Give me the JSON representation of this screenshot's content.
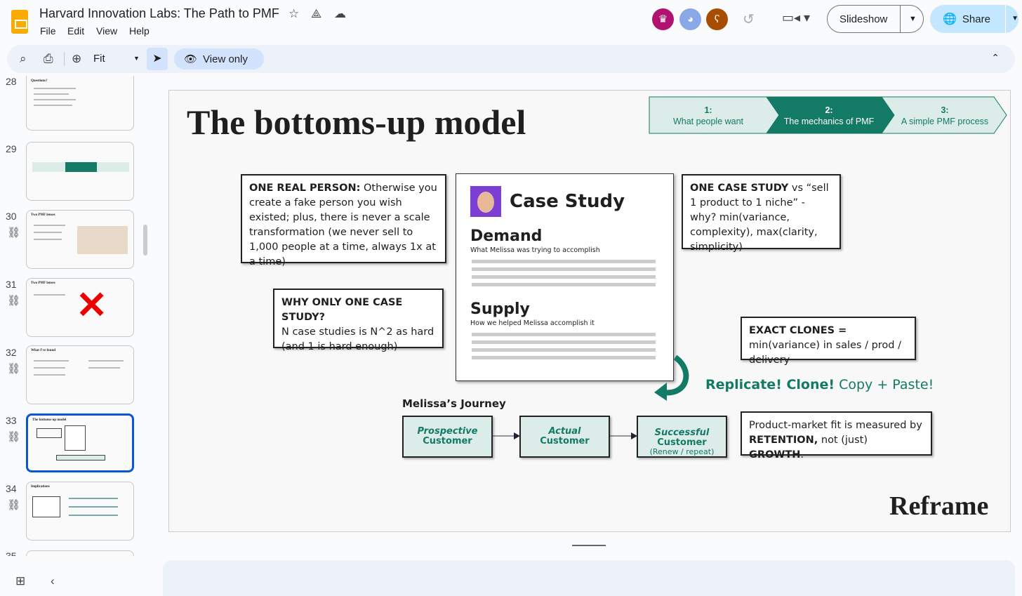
{
  "app": {
    "title": "Harvard Innovation Labs: The Path to PMF",
    "menu": [
      "File",
      "Edit",
      "View",
      "Help"
    ],
    "slideshow": "Slideshow",
    "share": "Share"
  },
  "toolbar": {
    "zoom": "Fit",
    "view_only": "View only"
  },
  "sidebar": {
    "slides": [
      "28",
      "29",
      "30",
      "31",
      "32",
      "33",
      "34",
      "35"
    ],
    "selected": "33",
    "thumb_titles": [
      "Questions?",
      "",
      "Two PMF lenses",
      "Two PMF lenses",
      "What I've found",
      "The bottoms-up model",
      "Implications"
    ]
  },
  "slide": {
    "title": "The bottoms-up model",
    "steps": [
      {
        "num": "1:",
        "label": "What people want"
      },
      {
        "num": "2:",
        "label": "The mechanics of PMF"
      },
      {
        "num": "3:",
        "label": "A simple PMF process"
      }
    ],
    "callout_person": {
      "bold": "ONE REAL PERSON:",
      "text": " Otherwise you create a fake person you wish existed; plus, there is never a scale transformation (we never sell to 1,000 people at a time, always 1x at a time)"
    },
    "callout_case": {
      "bold": "ONE CASE STUDY",
      "text": " vs “sell 1 product to 1 niche” - why? min(variance, complexity), max(clarity, simplicity)"
    },
    "callout_why": {
      "bold": "WHY ONLY ONE CASE STUDY?",
      "text": "N case studies is N^2 as hard (and 1 is hard enough)"
    },
    "callout_clones": {
      "bold": "EXACT CLONES =",
      "text": " min(variance) in sales / prod / delivery"
    },
    "case_study": {
      "title": "Case Study",
      "demand": "Demand",
      "demand_sub": "What Melissa was trying to accomplish",
      "supply": "Supply",
      "supply_sub": "How we helped Melissa accomplish it"
    },
    "replicate": {
      "bold": "Replicate! Clone!",
      "text": " Copy + Paste!"
    },
    "journey": {
      "label": "Melissa’s Journey",
      "steps": [
        {
          "italic": "Prospective",
          "main": "Customer"
        },
        {
          "italic": "Actual",
          "main": "Customer"
        },
        {
          "italic": "Successful",
          "main": "Customer",
          "sub": "(Renew / repeat)"
        }
      ]
    },
    "pmf": {
      "t1": "Product-market fit is measured by ",
      "b1": "RETENTION,",
      "t2": " not (just) ",
      "b2": "GROWTH",
      "t3": "."
    },
    "brand": "Reframe"
  },
  "colors": {
    "accent": "#137a66",
    "light": "#dcece8",
    "share_bg": "#c2e7ff",
    "selected": "#0b57d0"
  }
}
